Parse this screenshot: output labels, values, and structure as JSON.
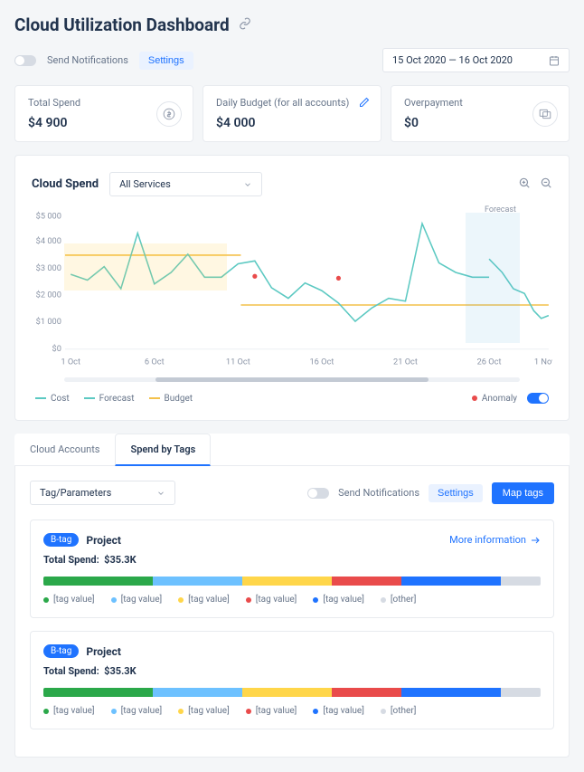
{
  "title": "Cloud Utilization Dashboard",
  "top": {
    "sendNotifications": "Send Notifications",
    "settings": "Settings",
    "dateRange": "15 Oct 2020 — 16 Oct 2020"
  },
  "cards": {
    "totalSpend": {
      "label": "Total Spend",
      "value": "$4 900"
    },
    "dailyBudget": {
      "label": "Daily Budget (for all accounts)",
      "value": "$4 000"
    },
    "overpayment": {
      "label": "Overpayment",
      "value": "$0"
    }
  },
  "chart": {
    "title": "Cloud Spend",
    "selector": "All Services",
    "forecastLabel": "Forecast",
    "legend": {
      "cost": "Cost",
      "forecast": "Forecast",
      "budget": "Budget",
      "anomaly": "Anomaly"
    }
  },
  "chart_data": {
    "type": "line",
    "xlabel": "",
    "ylabel": "",
    "ylim": [
      0,
      5000
    ],
    "y_ticks": [
      "$0",
      "$1 000",
      "$2 000",
      "$3 000",
      "$4 000",
      "$5 000"
    ],
    "x_ticks": [
      "1 Oct",
      "6 Oct",
      "11 Oct",
      "16 Oct",
      "21 Oct",
      "26 Oct",
      "1 Nov"
    ],
    "series": [
      {
        "name": "Cost",
        "color": "#5cc9c2",
        "values": [
          2700,
          2500,
          3000,
          2200,
          4300,
          2400,
          2800,
          3500,
          2600,
          2600,
          3100,
          3200,
          2200,
          1800,
          2400,
          2100,
          1700,
          1000,
          1500,
          1900,
          1800,
          4700,
          3200,
          2800,
          2600,
          2600
        ]
      },
      {
        "name": "Forecast",
        "color": "#5cc9c2",
        "values_from_index": 25,
        "values": [
          3300,
          2800,
          2200,
          2000,
          1400,
          1100,
          1200
        ]
      },
      {
        "name": "Budget",
        "color": "#f4c14a",
        "values_constant": 3500,
        "after_index": 12,
        "value_after": 1600
      }
    ],
    "anomalies": [
      {
        "x_index": 15,
        "value": 2100
      }
    ],
    "forecast_band_start_index": 25,
    "budget_band": {
      "start_index": 0,
      "end_index": 11,
      "upper": 3500,
      "lower": 2000
    }
  },
  "tabs": {
    "accounts": "Cloud Accounts",
    "byTags": "Spend by Tags"
  },
  "tagsPanel": {
    "selector": "Tag/Parameters",
    "sendNotifications": "Send Notifications",
    "settings": "Settings",
    "mapTags": "Map tags",
    "moreInfo": "More information",
    "cards": [
      {
        "pill": "B-tag",
        "name": "Project",
        "spendLabel": "Total Spend:",
        "spendValue": "$35.3K",
        "segments": [
          {
            "color": "#2ba84a",
            "pct": 22
          },
          {
            "color": "#6dc1ff",
            "pct": 18
          },
          {
            "color": "#ffd64a",
            "pct": 18
          },
          {
            "color": "#e94b4b",
            "pct": 14
          },
          {
            "color": "#1f73ff",
            "pct": 20
          },
          {
            "color": "#d6dbe3",
            "pct": 8
          }
        ],
        "legendValues": [
          "[tag value]",
          "[tag value]",
          "[tag value]",
          "[tag value]",
          "[tag value]",
          "[other]"
        ]
      },
      {
        "pill": "B-tag",
        "name": "Project",
        "spendLabel": "Total Spend:",
        "spendValue": "$35.3K",
        "segments": [
          {
            "color": "#2ba84a",
            "pct": 22
          },
          {
            "color": "#6dc1ff",
            "pct": 18
          },
          {
            "color": "#ffd64a",
            "pct": 18
          },
          {
            "color": "#e94b4b",
            "pct": 14
          },
          {
            "color": "#1f73ff",
            "pct": 20
          },
          {
            "color": "#d6dbe3",
            "pct": 8
          }
        ],
        "legendValues": [
          "[tag value]",
          "[tag value]",
          "[tag value]",
          "[tag value]",
          "[tag value]",
          "[other]"
        ]
      }
    ]
  }
}
